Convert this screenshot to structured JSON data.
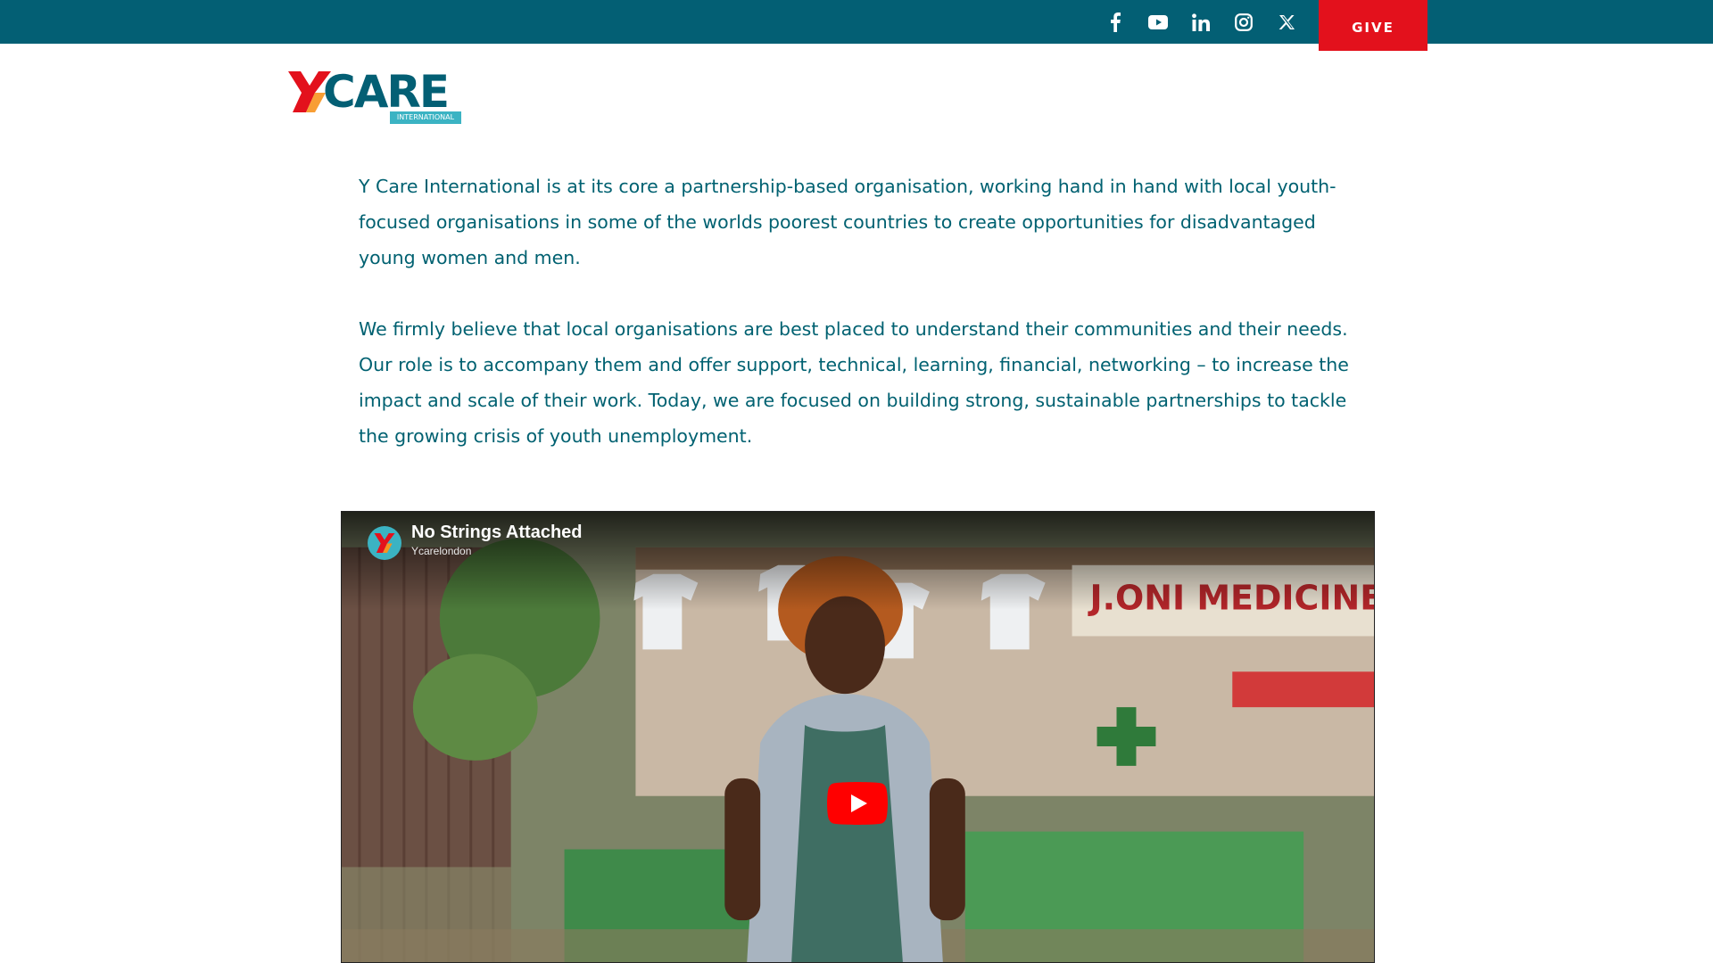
{
  "topbar": {
    "social_icons": [
      "facebook-icon",
      "youtube-icon",
      "linkedin-icon",
      "instagram-icon",
      "x-icon"
    ],
    "give_label": "GIVE"
  },
  "logo": {
    "wordmark": "CARE",
    "sub": "INTERNATIONAL"
  },
  "content": {
    "paragraphs": [
      "Y Care International is at its core a partnership-based organisation, working hand in hand with local youth-focused organisations in some of the worlds poorest countries to create opportunities for disadvantaged young women and men.",
      "We firmly believe that local organisations are best placed to understand their communities and their needs. Our role is to accompany them and offer support, technical, learning, financial, networking – to increase the impact and scale of their work. Today, we are focused on building strong, sustainable partnerships to tackle the growing crisis of youth unemployment."
    ]
  },
  "video": {
    "title": "No Strings Attached",
    "channel": "Ycarelondon",
    "sign_text": "J.ONI MEDICINES"
  },
  "colors": {
    "topbar": "#035f74",
    "give": "#e3111c",
    "text": "#006171",
    "logo_accent": "#3bb3c3"
  }
}
